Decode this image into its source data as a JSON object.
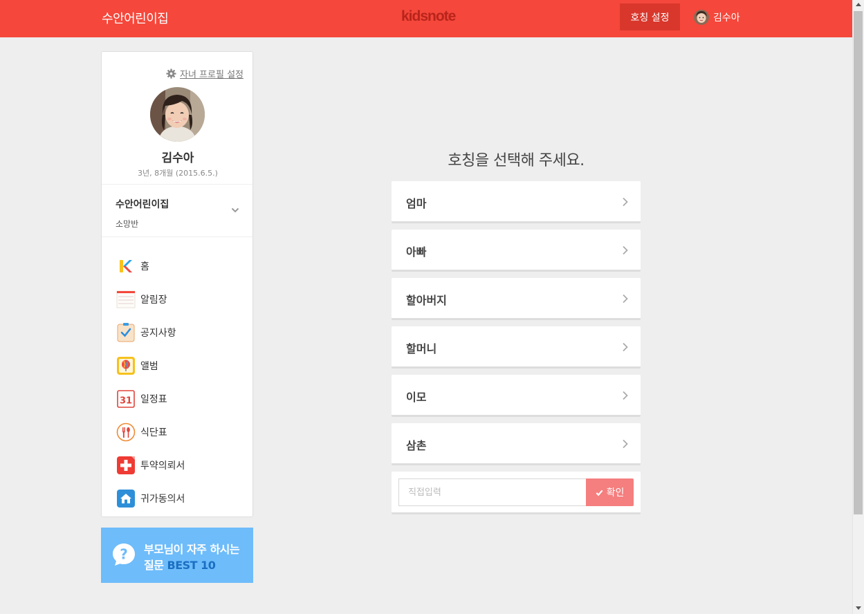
{
  "header": {
    "school_title": "수안어린이집",
    "logo_text": "kidsnote",
    "nickname_button": "호칭 설정",
    "user_name": "김수아",
    "bar_color": "#f5473b"
  },
  "sidebar": {
    "profile_settings_link": "자녀 프로필 설정",
    "child_name": "김수아",
    "child_age": "3년, 8개월 (2015.6.5.)",
    "school_name": "수안어린이집",
    "class_name": "소망반",
    "menu": [
      {
        "label": "홈",
        "icon": "kidsnote-home-icon"
      },
      {
        "label": "알림장",
        "icon": "notebook-icon"
      },
      {
        "label": "공지사항",
        "icon": "clipboard-check-icon"
      },
      {
        "label": "앨범",
        "icon": "album-balloon-icon"
      },
      {
        "label": "일정표",
        "icon": "calendar-icon",
        "icon_text": "31"
      },
      {
        "label": "식단표",
        "icon": "fork-spoon-icon"
      },
      {
        "label": "투약의뢰서",
        "icon": "medical-cross-icon"
      },
      {
        "label": "귀가동의서",
        "icon": "house-icon"
      }
    ]
  },
  "faq_banner": {
    "line1": "부모님이 자주 하시는",
    "line2_prefix": "질문 ",
    "line2_highlight": "BEST 10"
  },
  "main": {
    "title": "호칭을 선택해 주세요.",
    "options": [
      "엄마",
      "아빠",
      "할아버지",
      "할머니",
      "이모",
      "삼촌"
    ],
    "custom_input_placeholder": "직접입력",
    "confirm_button": "확인"
  }
}
